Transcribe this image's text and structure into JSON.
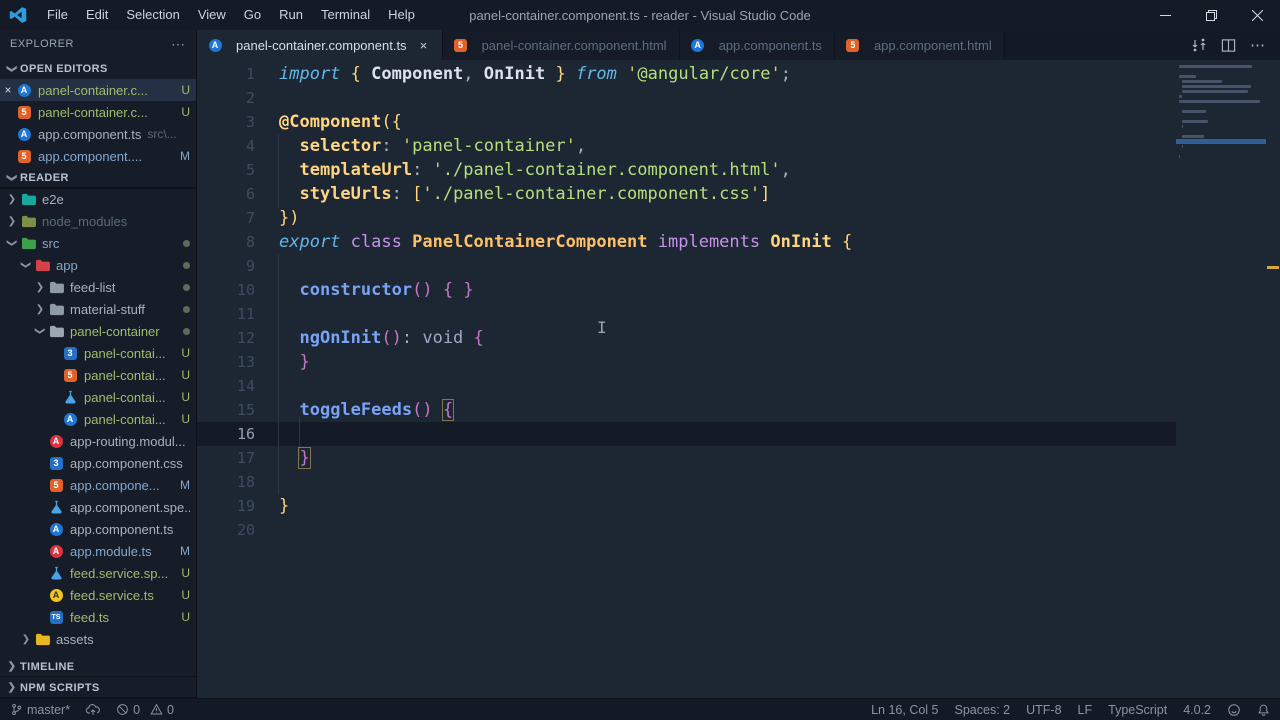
{
  "window": {
    "title": "panel-container.component.ts - reader - Visual Studio Code",
    "controls": [
      {
        "name": "minimize",
        "glyph": "minimize"
      },
      {
        "name": "restore",
        "glyph": "restore"
      },
      {
        "name": "close",
        "glyph": "close"
      }
    ]
  },
  "menu_bar": [
    "File",
    "Edit",
    "Selection",
    "View",
    "Go",
    "Run",
    "Terminal",
    "Help"
  ],
  "tabs": {
    "items": [
      {
        "label": "panel-container.component.ts",
        "icon": "angular-blue",
        "active": true,
        "close": "×"
      },
      {
        "label": "panel-container.component.html",
        "icon": "html",
        "active": false
      },
      {
        "label": "app.component.ts",
        "icon": "angular-blue",
        "active": false
      },
      {
        "label": "app.component.html",
        "icon": "html",
        "active": false
      }
    ],
    "actions": [
      {
        "name": "open-changes"
      },
      {
        "name": "split-editor"
      },
      {
        "name": "more-actions"
      }
    ]
  },
  "sidebar": {
    "title": "EXPLORER",
    "title_action": "⋯",
    "open_editors": {
      "label": "OPEN EDITORS",
      "expanded": true,
      "items": [
        {
          "icon": "angular-blue",
          "label": "panel-container.c...",
          "badge": "U",
          "cls": "c-green",
          "active": true,
          "close": "×"
        },
        {
          "icon": "html",
          "label": "panel-container.c...",
          "badge": "U",
          "cls": "c-green"
        },
        {
          "icon": "angular-blue",
          "label": "app.component.ts",
          "desc": "src\\...",
          "cls": "c-norm"
        },
        {
          "icon": "html",
          "label": "app.component....",
          "badge": "M",
          "cls": "c-mod"
        }
      ]
    },
    "folders": {
      "label": "READER",
      "expanded": true,
      "items": [
        {
          "depth": 1,
          "chev": "closed",
          "icon": "folder-e2e",
          "label": "e2e",
          "cls": "c-norm"
        },
        {
          "depth": 1,
          "chev": "closed",
          "icon": "folder-nm",
          "label": "node_modules",
          "cls": "c-dim"
        },
        {
          "depth": 1,
          "chev": "open",
          "icon": "folder-src",
          "label": "src",
          "cls": "c-mod",
          "dot": true
        },
        {
          "depth": 2,
          "chev": "open",
          "icon": "folder-app",
          "label": "app",
          "cls": "c-mod",
          "dot": true
        },
        {
          "depth": 3,
          "chev": "closed",
          "icon": "folder",
          "label": "feed-list",
          "cls": "c-norm",
          "dot": true
        },
        {
          "depth": 3,
          "chev": "closed",
          "icon": "folder",
          "label": "material-stuff",
          "cls": "c-norm",
          "dot": true
        },
        {
          "depth": 3,
          "chev": "open",
          "icon": "folder-open",
          "label": "panel-container",
          "cls": "c-green",
          "dot": true
        },
        {
          "depth": 4,
          "icon": "css",
          "label": "panel-contai...",
          "badge": "U",
          "cls": "c-green"
        },
        {
          "depth": 4,
          "icon": "html",
          "label": "panel-contai...",
          "badge": "U",
          "cls": "c-green"
        },
        {
          "depth": 4,
          "icon": "flask",
          "label": "panel-contai...",
          "badge": "U",
          "cls": "c-green"
        },
        {
          "depth": 4,
          "icon": "angular-blue",
          "label": "panel-contai...",
          "badge": "U",
          "cls": "c-green"
        },
        {
          "depth": 3,
          "icon": "angular-red",
          "label": "app-routing.modul...",
          "cls": "c-norm"
        },
        {
          "depth": 3,
          "icon": "css",
          "label": "app.component.css",
          "cls": "c-norm"
        },
        {
          "depth": 3,
          "icon": "html",
          "label": "app.compone...",
          "badge": "M",
          "cls": "c-mod"
        },
        {
          "depth": 3,
          "icon": "flask",
          "label": "app.component.spe...",
          "cls": "c-norm"
        },
        {
          "depth": 3,
          "icon": "angular-blue",
          "label": "app.component.ts",
          "cls": "c-norm"
        },
        {
          "depth": 3,
          "icon": "angular-red",
          "label": "app.module.ts",
          "badge": "M",
          "cls": "c-mod"
        },
        {
          "depth": 3,
          "icon": "flask",
          "label": "feed.service.sp...",
          "badge": "U",
          "cls": "c-green"
        },
        {
          "depth": 3,
          "icon": "angular-yellow",
          "label": "feed.service.ts",
          "badge": "U",
          "cls": "c-green"
        },
        {
          "depth": 3,
          "icon": "ts",
          "label": "feed.ts",
          "badge": "U",
          "cls": "c-green"
        },
        {
          "depth": 2,
          "chev": "closed",
          "icon": "folder-assets",
          "label": "assets",
          "cls": "c-norm"
        }
      ]
    },
    "bottom_sections": [
      {
        "label": "TIMELINE",
        "chev": "closed"
      },
      {
        "label": "NPM SCRIPTS",
        "chev": "closed"
      }
    ]
  },
  "editor": {
    "current_line": 16,
    "lines": [
      {
        "n": 1,
        "tokens": [
          [
            "kw",
            "import"
          ],
          [
            "fg",
            " "
          ],
          [
            "py",
            "{"
          ],
          [
            "fg",
            " "
          ],
          [
            "id",
            "Component"
          ],
          [
            "fg",
            ", "
          ],
          [
            "id",
            "OnInit"
          ],
          [
            "fg",
            " "
          ],
          [
            "py",
            "}"
          ],
          [
            "fg",
            " "
          ],
          [
            "kw",
            "from"
          ],
          [
            "fg",
            " "
          ],
          [
            "q",
            "'"
          ],
          [
            "str",
            "@angular/core"
          ],
          [
            "q",
            "'"
          ],
          [
            "fg",
            ";"
          ]
        ]
      },
      {
        "n": 2,
        "tokens": []
      },
      {
        "n": 3,
        "tokens": [
          [
            "dec",
            "@Component"
          ],
          [
            "py",
            "({"
          ]
        ]
      },
      {
        "n": 4,
        "tokens": [
          [
            "fg",
            "  "
          ],
          [
            "prop",
            "selector"
          ],
          [
            "fg",
            ": "
          ],
          [
            "q",
            "'"
          ],
          [
            "str",
            "panel-container"
          ],
          [
            "q",
            "'"
          ],
          [
            "fg",
            ","
          ]
        ]
      },
      {
        "n": 5,
        "tokens": [
          [
            "fg",
            "  "
          ],
          [
            "prop",
            "templateUrl"
          ],
          [
            "fg",
            ": "
          ],
          [
            "q",
            "'"
          ],
          [
            "str",
            "./panel-container.component.html"
          ],
          [
            "q",
            "'"
          ],
          [
            "fg",
            ","
          ]
        ]
      },
      {
        "n": 6,
        "tokens": [
          [
            "fg",
            "  "
          ],
          [
            "prop",
            "styleUrls"
          ],
          [
            "fg",
            ": "
          ],
          [
            "py",
            "["
          ],
          [
            "q",
            "'"
          ],
          [
            "str",
            "./panel-container.component.css"
          ],
          [
            "q",
            "'"
          ],
          [
            "py",
            "]"
          ]
        ]
      },
      {
        "n": 7,
        "tokens": [
          [
            "py",
            "})"
          ]
        ]
      },
      {
        "n": 8,
        "tokens": [
          [
            "kw",
            "export"
          ],
          [
            "fg",
            " "
          ],
          [
            "kw2",
            "class"
          ],
          [
            "fg",
            " "
          ],
          [
            "cls",
            "PanelContainerComponent"
          ],
          [
            "fg",
            " "
          ],
          [
            "kw2",
            "implements"
          ],
          [
            "fg",
            " "
          ],
          [
            "iface",
            "OnInit"
          ],
          [
            "fg",
            " "
          ],
          [
            "py",
            "{"
          ]
        ]
      },
      {
        "n": 9,
        "tokens": []
      },
      {
        "n": 10,
        "tokens": [
          [
            "fg",
            "  "
          ],
          [
            "fn",
            "constructor"
          ],
          [
            "pm",
            "()"
          ],
          [
            "fg",
            " "
          ],
          [
            "pm",
            "{"
          ],
          [
            "fg",
            " "
          ],
          [
            "pm",
            "}"
          ]
        ]
      },
      {
        "n": 11,
        "tokens": []
      },
      {
        "n": 12,
        "tokens": [
          [
            "fg",
            "  "
          ],
          [
            "fn",
            "ngOnInit"
          ],
          [
            "pm",
            "()"
          ],
          [
            "fg",
            ": "
          ],
          [
            "void",
            "void"
          ],
          [
            "fg",
            " "
          ],
          [
            "pm",
            "{"
          ]
        ]
      },
      {
        "n": 13,
        "tokens": [
          [
            "fg",
            "  "
          ],
          [
            "pm",
            "}"
          ]
        ]
      },
      {
        "n": 14,
        "tokens": []
      },
      {
        "n": 15,
        "tokens": [
          [
            "fg",
            "  "
          ],
          [
            "fn",
            "toggleFeeds"
          ],
          [
            "pm",
            "()"
          ],
          [
            "fg",
            " "
          ],
          [
            "pmb",
            "{"
          ]
        ]
      },
      {
        "n": 16,
        "tokens": []
      },
      {
        "n": 17,
        "tokens": [
          [
            "fg",
            "  "
          ],
          [
            "pmb",
            "}"
          ]
        ]
      },
      {
        "n": 18,
        "tokens": []
      },
      {
        "n": 19,
        "tokens": [
          [
            "py",
            "}"
          ]
        ]
      },
      {
        "n": 20,
        "tokens": []
      }
    ]
  },
  "status_bar": {
    "branch": "master*",
    "errors": "0",
    "warnings": "0",
    "right_items": [
      "Ln 16, Col 5",
      "Spaces: 2",
      "UTF-8",
      "LF",
      "TypeScript",
      "4.0.2"
    ]
  },
  "colors": {
    "accent_blue": "#7aa2f7",
    "string_green": "#b5e07c",
    "gold": "#ffd580",
    "untracked_green": "#9fbc6d",
    "modified_blue": "#84a7cd",
    "angular_red": "#dd3340",
    "html_orange": "#e0622a",
    "css_blue": "#2965f1",
    "service_yellow": "#f2c41d"
  }
}
